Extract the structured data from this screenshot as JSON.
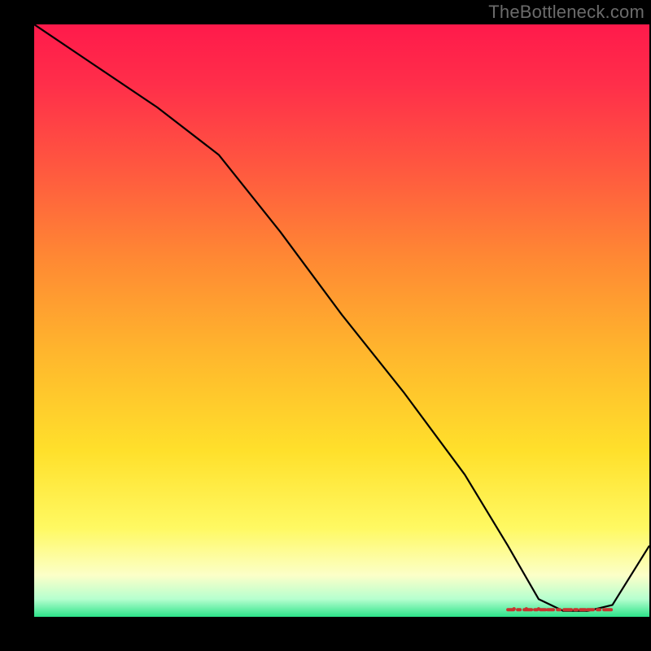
{
  "attribution": "TheBottleneck.com",
  "chart_data": {
    "type": "line",
    "title": "",
    "xlabel": "",
    "ylabel": "",
    "xlim": [
      0,
      100
    ],
    "ylim": [
      0,
      100
    ],
    "x": [
      0,
      10,
      20,
      30,
      40,
      50,
      60,
      70,
      77,
      82,
      86,
      90,
      94,
      100
    ],
    "values": [
      100,
      93,
      86,
      78,
      65,
      51,
      38,
      24,
      12,
      3,
      1,
      1,
      2,
      12
    ],
    "optimal_band_x": [
      77,
      94
    ],
    "marker_points_x": [
      78,
      80,
      82,
      83,
      85,
      86,
      88,
      89,
      90,
      91,
      92,
      93
    ]
  }
}
